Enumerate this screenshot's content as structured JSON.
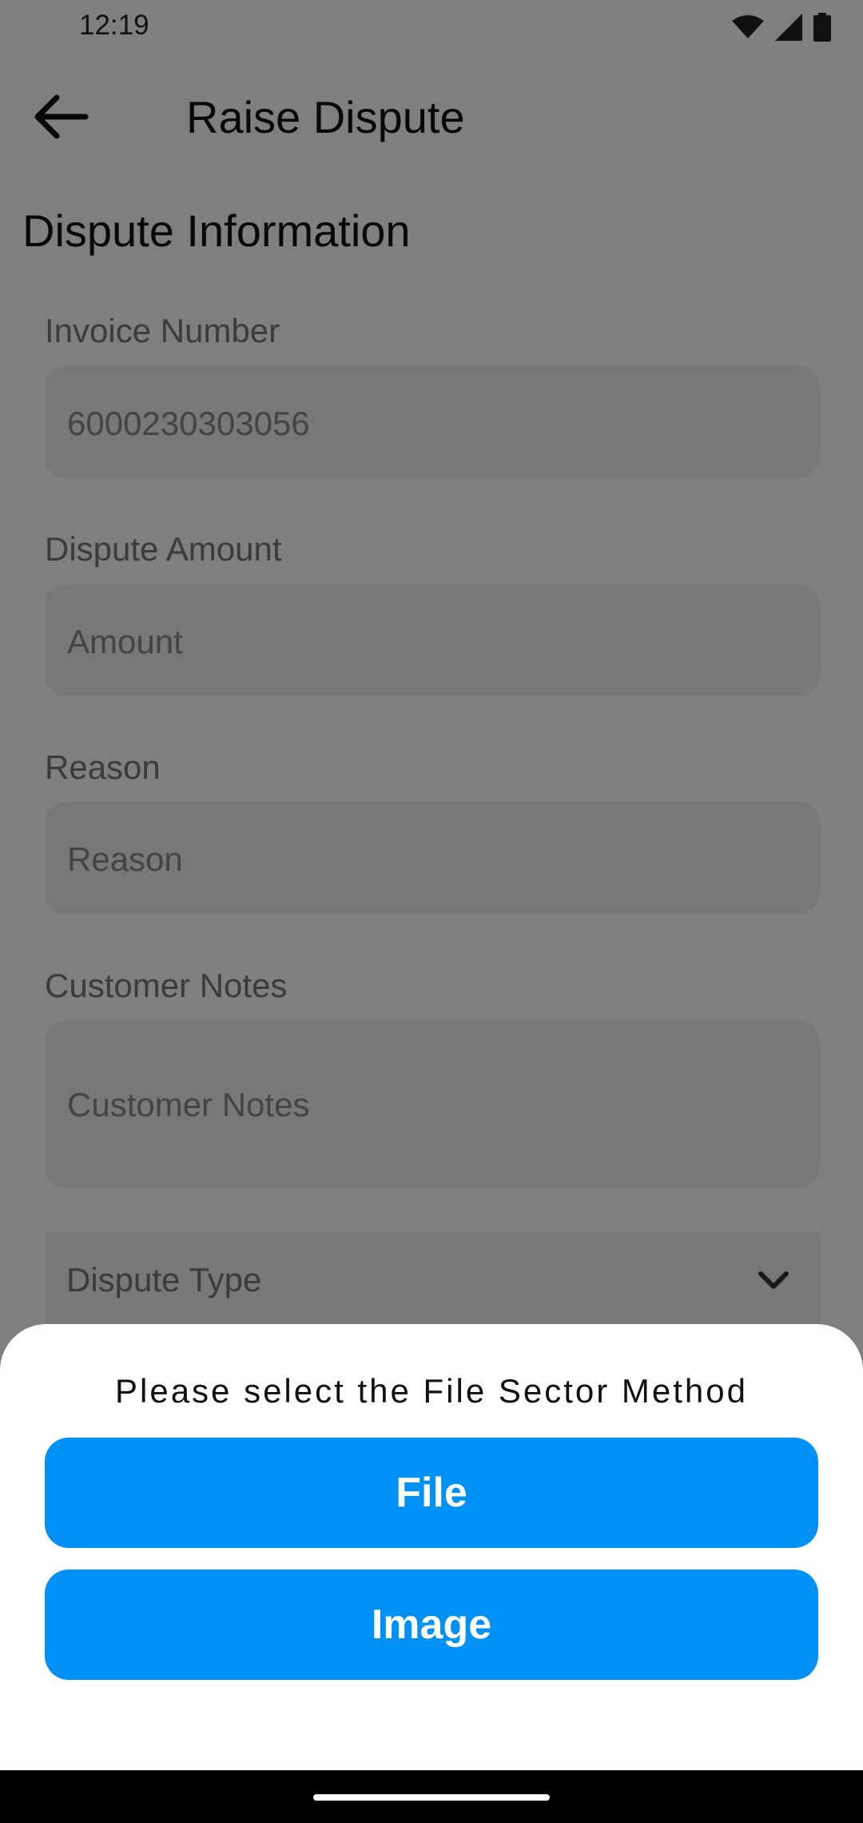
{
  "status_bar": {
    "time": "12:19",
    "icons": [
      "wifi-icon",
      "signal-icon",
      "battery-icon"
    ]
  },
  "app_bar": {
    "back_icon": "arrow-left-icon",
    "title": "Raise Dispute"
  },
  "form": {
    "section_title": "Dispute Information",
    "invoice_number": {
      "label": "Invoice Number",
      "value": "6000230303056"
    },
    "dispute_amount": {
      "label": "Dispute Amount",
      "placeholder": "Amount"
    },
    "reason": {
      "label": "Reason",
      "placeholder": "Reason"
    },
    "customer_notes": {
      "label": "Customer Notes",
      "placeholder": "Customer Notes"
    },
    "dispute_type": {
      "placeholder": "Dispute Type",
      "icon": "chevron-down-icon"
    }
  },
  "sheet": {
    "title": "Please select the File Sector Method",
    "file_button": "File",
    "image_button": "Image"
  },
  "colors": {
    "accent": "#0091F6",
    "scrim": "#00000080"
  }
}
